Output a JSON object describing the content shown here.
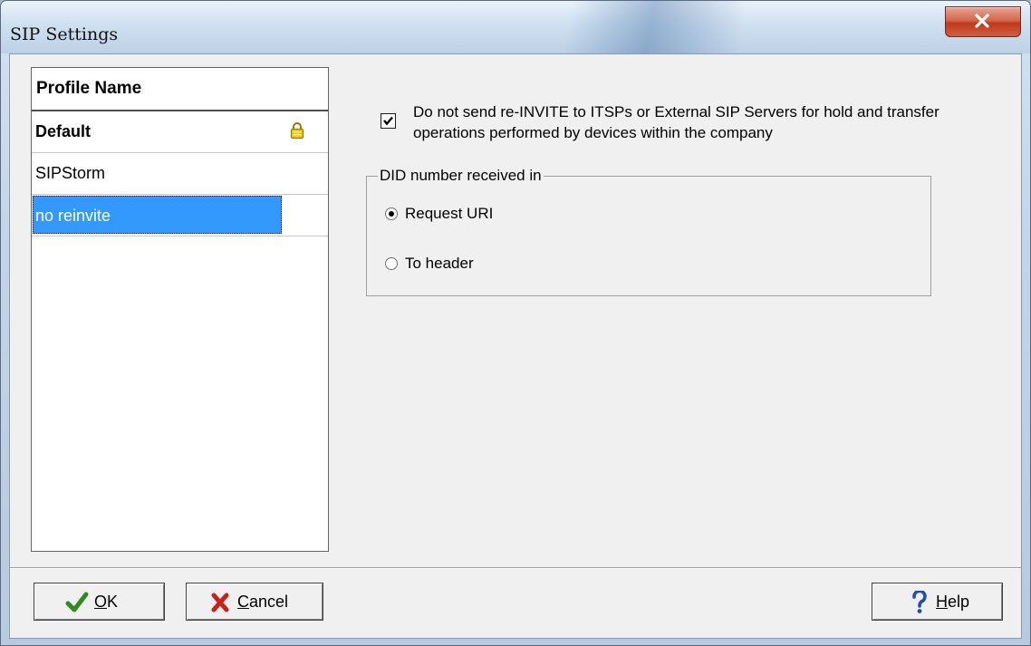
{
  "window": {
    "title": "SIP Settings"
  },
  "profiles": {
    "header": "Profile Name",
    "items": [
      {
        "label": "Default"
      },
      {
        "label": "SIPStorm"
      },
      {
        "label": "no reinvite"
      }
    ]
  },
  "options": {
    "reinvite_label": "Do not send re-INVITE to ITSPs or External SIP Servers for hold and transfer operations performed by devices within the company",
    "reinvite_checked": true,
    "did_group_label": "DID number received in",
    "did_options": [
      {
        "label": "Request URI",
        "selected": true
      },
      {
        "label": "To header",
        "selected": false
      }
    ]
  },
  "buttons": {
    "ok": {
      "hotkey": "O",
      "rest": "K"
    },
    "cancel": {
      "hotkey": "C",
      "rest": "ancel"
    },
    "help": {
      "hotkey": "H",
      "rest": "elp"
    }
  },
  "icons": {
    "close": "close-icon",
    "lock": "lock-icon",
    "ok": "checkmark-icon",
    "cancel": "x-icon",
    "help": "question-mark-icon"
  },
  "colors": {
    "selection": "#3399ff",
    "ok_icon": "#2e8b1e",
    "cancel_icon": "#c8201a",
    "help_icon": "#1f4fb5",
    "lock_icon": "#e8b400"
  }
}
